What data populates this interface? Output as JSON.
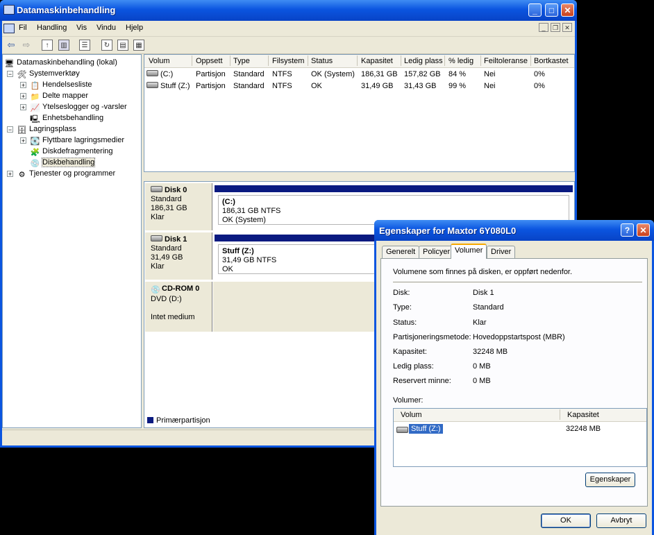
{
  "main_window": {
    "title": "Datamaskinbehandling",
    "menu": [
      "Fil",
      "Handling",
      "Vis",
      "Vindu",
      "Hjelp"
    ],
    "controls": {
      "minimize": "_",
      "maximize": "□",
      "close": "✕"
    },
    "mdi_controls": {
      "minimize": "_",
      "restore": "❐",
      "close": "✕"
    }
  },
  "tree": {
    "root": "Datamaskinbehandling (lokal)",
    "systemverktoy": "Systemverktøy",
    "hendelsesliste": "Hendelsesliste",
    "delte_mapper": "Delte mapper",
    "ytelseslogger": "Ytelseslogger og -varsler",
    "enhetsbehandling": "Enhetsbehandling",
    "lagringsplass": "Lagringsplass",
    "flyttbare": "Flyttbare lagringsmedier",
    "diskdefrag": "Diskdefragmentering",
    "diskbehandling": "Diskbehandling",
    "tjenester": "Tjenester og programmer",
    "expand_plus": "+",
    "expand_minus": "−"
  },
  "volume_list": {
    "columns": [
      "Volum",
      "Oppsett",
      "Type",
      "Filsystem",
      "Status",
      "Kapasitet",
      "Ledig plass",
      "% ledig",
      "Feiltoleranse",
      "Bortkastet"
    ],
    "rows": [
      [
        "(C:)",
        "Partisjon",
        "Standard",
        "NTFS",
        "OK (System)",
        "186,31 GB",
        "157,82 GB",
        "84 %",
        "Nei",
        "0%"
      ],
      [
        "Stuff (Z:)",
        "Partisjon",
        "Standard",
        "NTFS",
        "OK",
        "31,49 GB",
        "31,43 GB",
        "99 %",
        "Nei",
        "0%"
      ]
    ]
  },
  "disks": [
    {
      "name": "Disk 0",
      "type": "Standard",
      "size": "186,31 GB",
      "status": "Klar",
      "partition": {
        "name": "(C:)",
        "size": "186,31 GB NTFS",
        "status": "OK (System)"
      }
    },
    {
      "name": "Disk 1",
      "type": "Standard",
      "size": "31,49 GB",
      "status": "Klar",
      "partition": {
        "name": "Stuff  (Z:)",
        "size": "31,49 GB NTFS",
        "status": "OK"
      }
    },
    {
      "name": "CD-ROM 0",
      "type": "DVD (D:)",
      "status": "Intet medium"
    }
  ],
  "legend": {
    "primary": "Primærpartisjon"
  },
  "dialog": {
    "title": "Egenskaper for Maxtor 6Y080L0",
    "help": "?",
    "close": "✕",
    "tabs": [
      "Generelt",
      "Policyer",
      "Volumer",
      "Driver"
    ],
    "active_tab": "Volumer",
    "intro": "Volumene som finnes på disken, er oppført nedenfor.",
    "properties": [
      {
        "label": "Disk:",
        "value": "Disk 1"
      },
      {
        "label": "Type:",
        "value": "Standard"
      },
      {
        "label": "Status:",
        "value": "Klar"
      },
      {
        "label": "Partisjoneringsmetode:",
        "value": "Hovedoppstartspost (MBR)"
      },
      {
        "label": "Kapasitet:",
        "value": "32248 MB"
      },
      {
        "label": "Ledig plass:",
        "value": "0 MB"
      },
      {
        "label": "Reservert minne:",
        "value": "0 MB"
      }
    ],
    "volumes_label": "Volumer:",
    "volumes_columns": [
      "Volum",
      "Kapasitet"
    ],
    "volumes_rows": [
      {
        "volume": "Stuff (Z:)",
        "capacity": "32248 MB"
      }
    ],
    "properties_button": "Egenskaper",
    "ok_button": "OK",
    "cancel_button": "Avbryt"
  },
  "colors": {
    "titlebar": "#0b55e0",
    "primary_partition": "#0a1a80",
    "selection": "#316ac5"
  }
}
